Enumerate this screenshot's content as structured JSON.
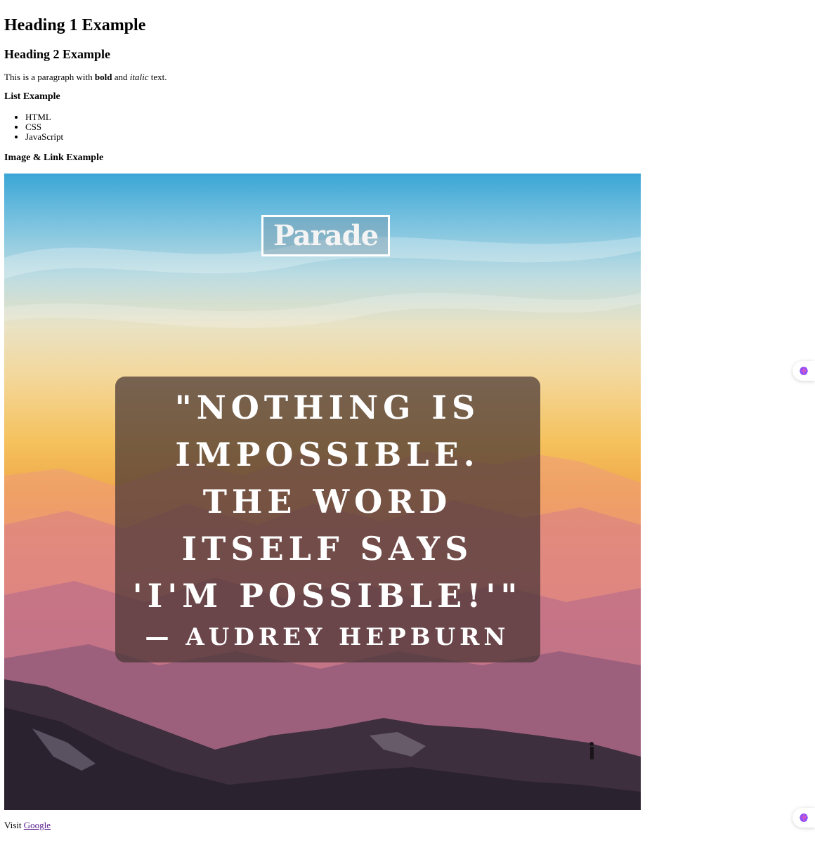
{
  "headings": {
    "h1": "Heading 1 Example",
    "h2": "Heading 2 Example",
    "list_heading": "List Example",
    "image_heading": "Image & Link Example"
  },
  "paragraph": {
    "before": "This is a paragraph with ",
    "bold": "bold",
    "middle": " and ",
    "italic": "italic",
    "after": " text."
  },
  "list": [
    "HTML",
    "CSS",
    "JavaScript"
  ],
  "image": {
    "logo_text": "Parade",
    "quote_lines": [
      "\"NOTHING IS",
      "IMPOSSIBLE.",
      "THE WORD",
      "ITSELF SAYS",
      "'I'M POSSIBLE!'\""
    ],
    "attribution": "— AUDREY HEPBURN"
  },
  "link": {
    "prefix": "Visit ",
    "text": "Google"
  },
  "extension": {
    "icon": "brain-icon",
    "accent": "#8a4dff"
  }
}
